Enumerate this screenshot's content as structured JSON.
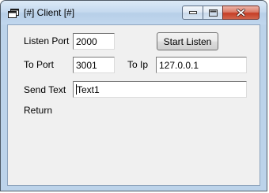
{
  "window": {
    "title": "[#] Client [#]",
    "icon": "window-app-icon",
    "controls": {
      "minimize_icon": "minimize-icon",
      "maximize_icon": "maximize-icon",
      "close_icon": "close-icon"
    }
  },
  "form": {
    "listen_port_label": "Listen Port",
    "listen_port_value": "2000",
    "start_listen_label": "Start Listen",
    "to_port_label": "To Port",
    "to_port_value": "3001",
    "to_ip_label": "To Ip",
    "to_ip_value": "127.0.0.1",
    "send_text_label": "Send Text",
    "send_text_value": "Text1",
    "return_label": "Return"
  },
  "colors": {
    "close_button": "#c63d25",
    "titlebar": "#c6daef",
    "client_bg": "#f0f0f0"
  }
}
